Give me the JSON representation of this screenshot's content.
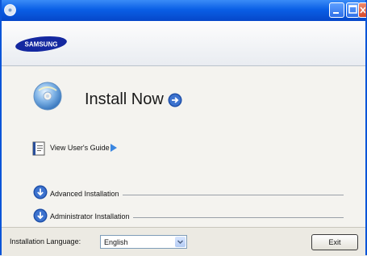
{
  "window": {
    "title": ""
  },
  "header": {
    "logo_text": "SAMSUNG"
  },
  "main": {
    "install_now": "Install Now",
    "view_guide": "View User's Guide",
    "options": [
      {
        "label": "Advanced Installation"
      },
      {
        "label": "Administrator Installation"
      }
    ]
  },
  "footer": {
    "language_label": "Installation Language:",
    "language_value": "English",
    "exit_label": "Exit"
  },
  "colors": {
    "titlebar": "#0a5fe6",
    "accent": "#1e5fc8",
    "logo": "#1428a0"
  }
}
